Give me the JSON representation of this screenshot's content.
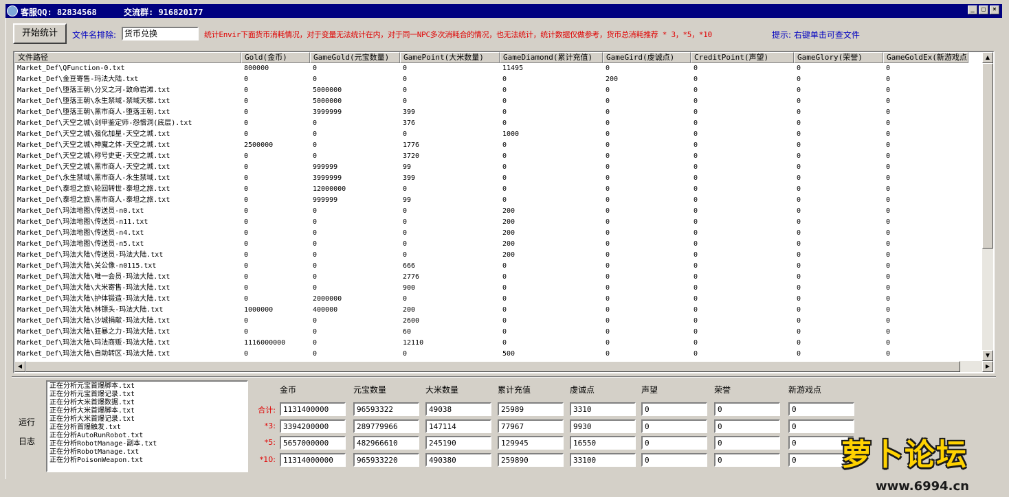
{
  "title": {
    "qq": "客服QQ: 82834568",
    "group": "交流群: 916820177"
  },
  "toolbar": {
    "start_label": "开始统计",
    "exclude_label": "文件名排除:",
    "exclude_value": "货币兑换",
    "note": "统计Envir下面货币消耗情况，对于变量无法统计在内，对于同一NPC多次消耗合的情况，也无法统计，统计数据仅做参考，货币总消耗推荐 * 3，*5，*10",
    "hint": "提示: 右键单击可查文件"
  },
  "table": {
    "columns": [
      "文件路径",
      "Gold(金币)",
      "GameGold(元宝数量)",
      "GamePoint(大米数量)",
      "GameDiamond(累计充值)",
      "GameGird(虔诚点)",
      "CreditPoint(声望)",
      "GameGlory(荣誉)",
      "GameGoldEx(新游戏点)"
    ],
    "rows": [
      [
        "Market_Def\\QFunction-0.txt",
        "800000",
        "0",
        "0",
        "11495",
        "0",
        "0",
        "0",
        "0"
      ],
      [
        "Market_Def\\金豆寄售-玛法大陆.txt",
        "0",
        "0",
        "0",
        "0",
        "200",
        "0",
        "0",
        "0"
      ],
      [
        "Market_Def\\堕落王朝\\分叉之河-致命岩滩.txt",
        "0",
        "5000000",
        "0",
        "0",
        "0",
        "0",
        "0",
        "0"
      ],
      [
        "Market_Def\\堕落王朝\\永生禁域-禁域天梯.txt",
        "0",
        "5000000",
        "0",
        "0",
        "0",
        "0",
        "0",
        "0"
      ],
      [
        "Market_Def\\堕落王朝\\黑市商人-堕落王朝.txt",
        "0",
        "3999999",
        "399",
        "0",
        "0",
        "0",
        "0",
        "0"
      ],
      [
        "Market_Def\\天空之城\\剑甲鉴定师-怨憎洞(底层).txt",
        "0",
        "0",
        "376",
        "0",
        "0",
        "0",
        "0",
        "0"
      ],
      [
        "Market_Def\\天空之城\\强化加星-天空之城.txt",
        "0",
        "0",
        "0",
        "1000",
        "0",
        "0",
        "0",
        "0"
      ],
      [
        "Market_Def\\天空之城\\神魔之体-天空之城.txt",
        "2500000",
        "0",
        "1776",
        "0",
        "0",
        "0",
        "0",
        "0"
      ],
      [
        "Market_Def\\天空之城\\称号史吏-天空之城.txt",
        "0",
        "0",
        "3720",
        "0",
        "0",
        "0",
        "0",
        "0"
      ],
      [
        "Market_Def\\天空之城\\黑市商人-天空之城.txt",
        "0",
        "999999",
        "99",
        "0",
        "0",
        "0",
        "0",
        "0"
      ],
      [
        "Market_Def\\永生禁域\\黑市商人-永生禁域.txt",
        "0",
        "3999999",
        "399",
        "0",
        "0",
        "0",
        "0",
        "0"
      ],
      [
        "Market_Def\\泰坦之旅\\轮回转世-泰坦之旅.txt",
        "0",
        "12000000",
        "0",
        "0",
        "0",
        "0",
        "0",
        "0"
      ],
      [
        "Market_Def\\泰坦之旅\\黑市商人-泰坦之旅.txt",
        "0",
        "999999",
        "99",
        "0",
        "0",
        "0",
        "0",
        "0"
      ],
      [
        "Market_Def\\玛法地图\\传送员-n0.txt",
        "0",
        "0",
        "0",
        "200",
        "0",
        "0",
        "0",
        "0"
      ],
      [
        "Market_Def\\玛法地图\\传送员-n11.txt",
        "0",
        "0",
        "0",
        "200",
        "0",
        "0",
        "0",
        "0"
      ],
      [
        "Market_Def\\玛法地图\\传送员-n4.txt",
        "0",
        "0",
        "0",
        "200",
        "0",
        "0",
        "0",
        "0"
      ],
      [
        "Market_Def\\玛法地图\\传送员-n5.txt",
        "0",
        "0",
        "0",
        "200",
        "0",
        "0",
        "0",
        "0"
      ],
      [
        "Market_Def\\玛法大陆\\传送员-玛法大陆.txt",
        "0",
        "0",
        "0",
        "200",
        "0",
        "0",
        "0",
        "0"
      ],
      [
        "Market_Def\\玛法大陆\\关公像-n0115.txt",
        "0",
        "0",
        "666",
        "0",
        "0",
        "0",
        "0",
        "0"
      ],
      [
        "Market_Def\\玛法大陆\\唯一会员-玛法大陆.txt",
        "0",
        "0",
        "2776",
        "0",
        "0",
        "0",
        "0",
        "0"
      ],
      [
        "Market_Def\\玛法大陆\\大米寄售-玛法大陆.txt",
        "0",
        "0",
        "900",
        "0",
        "0",
        "0",
        "0",
        "0"
      ],
      [
        "Market_Def\\玛法大陆\\护体锻造-玛法大陆.txt",
        "0",
        "2000000",
        "0",
        "0",
        "0",
        "0",
        "0",
        "0"
      ],
      [
        "Market_Def\\玛法大陆\\林镖头-玛法大陆.txt",
        "1000000",
        "400000",
        "200",
        "0",
        "0",
        "0",
        "0",
        "0"
      ],
      [
        "Market_Def\\玛法大陆\\沙城捐献-玛法大陆.txt",
        "0",
        "0",
        "2600",
        "0",
        "0",
        "0",
        "0",
        "0"
      ],
      [
        "Market_Def\\玛法大陆\\狂暴之力-玛法大陆.txt",
        "0",
        "0",
        "60",
        "0",
        "0",
        "0",
        "0",
        "0"
      ],
      [
        "Market_Def\\玛法大陆\\玛法商贩-玛法大陆.txt",
        "1116000000",
        "0",
        "12110",
        "0",
        "0",
        "0",
        "0",
        "0"
      ],
      [
        "Market_Def\\玛法大陆\\自助转区-玛法大陆.txt",
        "0",
        "0",
        "0",
        "500",
        "0",
        "0",
        "0",
        "0"
      ]
    ]
  },
  "log": {
    "label_top": "运行",
    "label_bottom": "日志",
    "lines": [
      "正在分析元宝首爆脚本.txt",
      "正在分析元宝首爆记录.txt",
      "正在分析大米首爆数据.txt",
      "正在分析大米首爆脚本.txt",
      "正在分析大米首爆记录.txt",
      "正在分析首爆触发.txt",
      "正在分析AutoRunRobot.txt",
      "正在分析RobotManage-副本.txt",
      "正在分析RobotManage.txt",
      "正在分析PoisonWeapon.txt"
    ]
  },
  "summary": {
    "headers": [
      "金币",
      "元宝数量",
      "大米数量",
      "累计充值",
      "虔诚点",
      "声望",
      "荣誉",
      "新游戏点"
    ],
    "rows": [
      {
        "label": "合计:",
        "values": [
          "1131400000",
          "96593322",
          "49038",
          "25989",
          "3310",
          "0",
          "0",
          "0"
        ]
      },
      {
        "label": "*3:",
        "values": [
          "3394200000",
          "289779966",
          "147114",
          "77967",
          "9930",
          "0",
          "0",
          "0"
        ]
      },
      {
        "label": "*5:",
        "values": [
          "5657000000",
          "482966610",
          "245190",
          "129945",
          "16550",
          "0",
          "0",
          "0"
        ]
      },
      {
        "label": "*10:",
        "values": [
          "11314000000",
          "965933220",
          "490380",
          "259890",
          "33100",
          "0",
          "0",
          "0"
        ]
      }
    ]
  },
  "watermark": {
    "text": "萝卜论坛",
    "url": "www.6994.cn"
  }
}
